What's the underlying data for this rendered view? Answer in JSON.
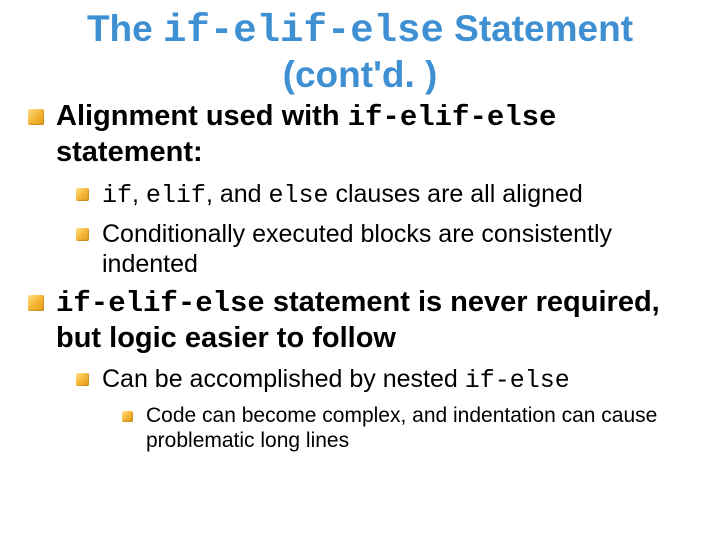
{
  "title": {
    "pre": "The ",
    "code": "if-elif-else",
    "post": " Statement",
    "line2": "(cont'd. )"
  },
  "bullets": {
    "b1": {
      "pre": "Alignment used with ",
      "code": "if-elif-else",
      "post": " statement:",
      "sub1": {
        "c1": "if",
        "sep1": ", ",
        "c2": "elif",
        "sep2": ", and ",
        "c3": "else",
        "post": " clauses are all aligned"
      },
      "sub2": "Conditionally executed blocks are consistently indented"
    },
    "b2": {
      "code": "if-elif-else",
      "post": " statement is never required, but logic easier to follow",
      "sub1": {
        "pre": "Can be accomplished by nested ",
        "code": "if-else"
      },
      "sub1a": "Code can become complex, and indentation can cause problematic long lines"
    }
  }
}
